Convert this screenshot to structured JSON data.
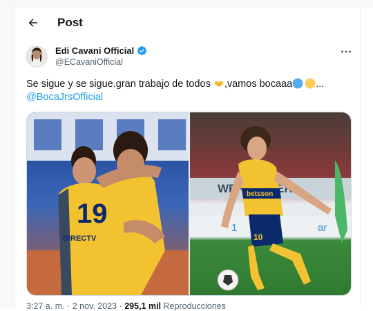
{
  "header": {
    "title": "Post"
  },
  "tweet": {
    "author_name": "Edi Cavani Official",
    "author_handle": "@ECavaniOfficial",
    "text": "Se sigue y se sigue.gran trabajo de todos ",
    "text_part2": ",vamos bocaaa",
    "text_ellipsis": "...",
    "mention": "@BocaJrsOfficial",
    "meta_time": "3:27 a. m. · 2 nov. 2023 · ",
    "meta_views": "295,1 mil",
    "meta_views_label": " Reproducciones"
  },
  "icons": {
    "back": "arrow-left-icon",
    "verified": "verified-badge-icon",
    "more": "more-horizontal-icon",
    "handshake": "handshake-emoji",
    "blue_circle": "blue-circle-emoji",
    "yellow_circle": "yellow-circle-emoji"
  },
  "colors": {
    "accent": "#1d9bf0",
    "text_primary": "#0f1419",
    "text_secondary": "#536471",
    "boca_blue": "#0a2a6b",
    "boca_yellow": "#f2c230"
  },
  "media": {
    "left_jersey_number": "19",
    "left_sponsor": "DIRECTV",
    "right_board_text": "WER POWER",
    "right_board_text2": "1",
    "right_board_text3": "ar",
    "right_jersey_number": "10",
    "right_sponsor": "betsson"
  }
}
